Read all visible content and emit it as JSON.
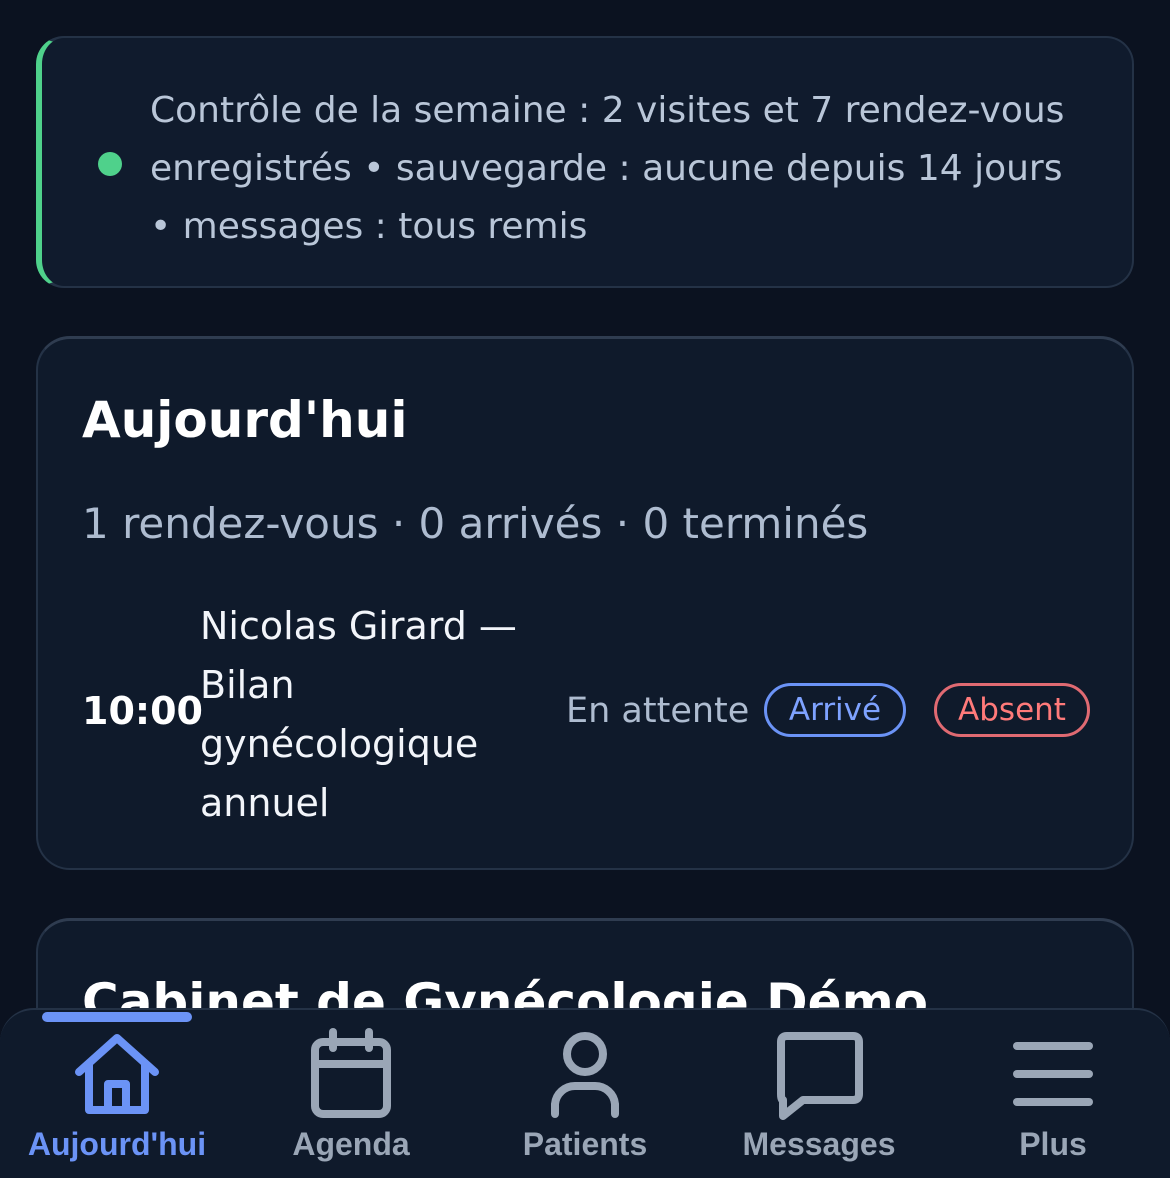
{
  "banner": {
    "text": "Contrôle de la semaine : 2 visites et 7 rendez-vous enregistrés • sauvegarde : aucune depuis 14 jours • messages : tous remis",
    "status_color": "#4fd18b"
  },
  "today": {
    "title": "Aujourd'hui",
    "summary": "1 rendez-vous · 0 arrivés · 0 terminés",
    "appointments": [
      {
        "time": "10:00",
        "description": "Nicolas Girard — Bilan gynécologique annuel",
        "status": "En attente",
        "arrive_label": "Arrivé",
        "absent_label": "Absent"
      }
    ]
  },
  "clinic": {
    "title": "Cabinet de Gynécologie Démo"
  },
  "nav": {
    "items": [
      {
        "label": "Aujourd'hui",
        "icon": "home-icon",
        "active": true
      },
      {
        "label": "Agenda",
        "icon": "calendar-icon",
        "active": false
      },
      {
        "label": "Patients",
        "icon": "user-icon",
        "active": false
      },
      {
        "label": "Messages",
        "icon": "message-icon",
        "active": false
      },
      {
        "label": "Plus",
        "icon": "menu-icon",
        "active": false
      }
    ]
  },
  "colors": {
    "accent": "#6b93f6",
    "danger": "#e06a72",
    "success": "#4fd18b",
    "background": "#0b1220",
    "card": "#0f1a2b"
  }
}
